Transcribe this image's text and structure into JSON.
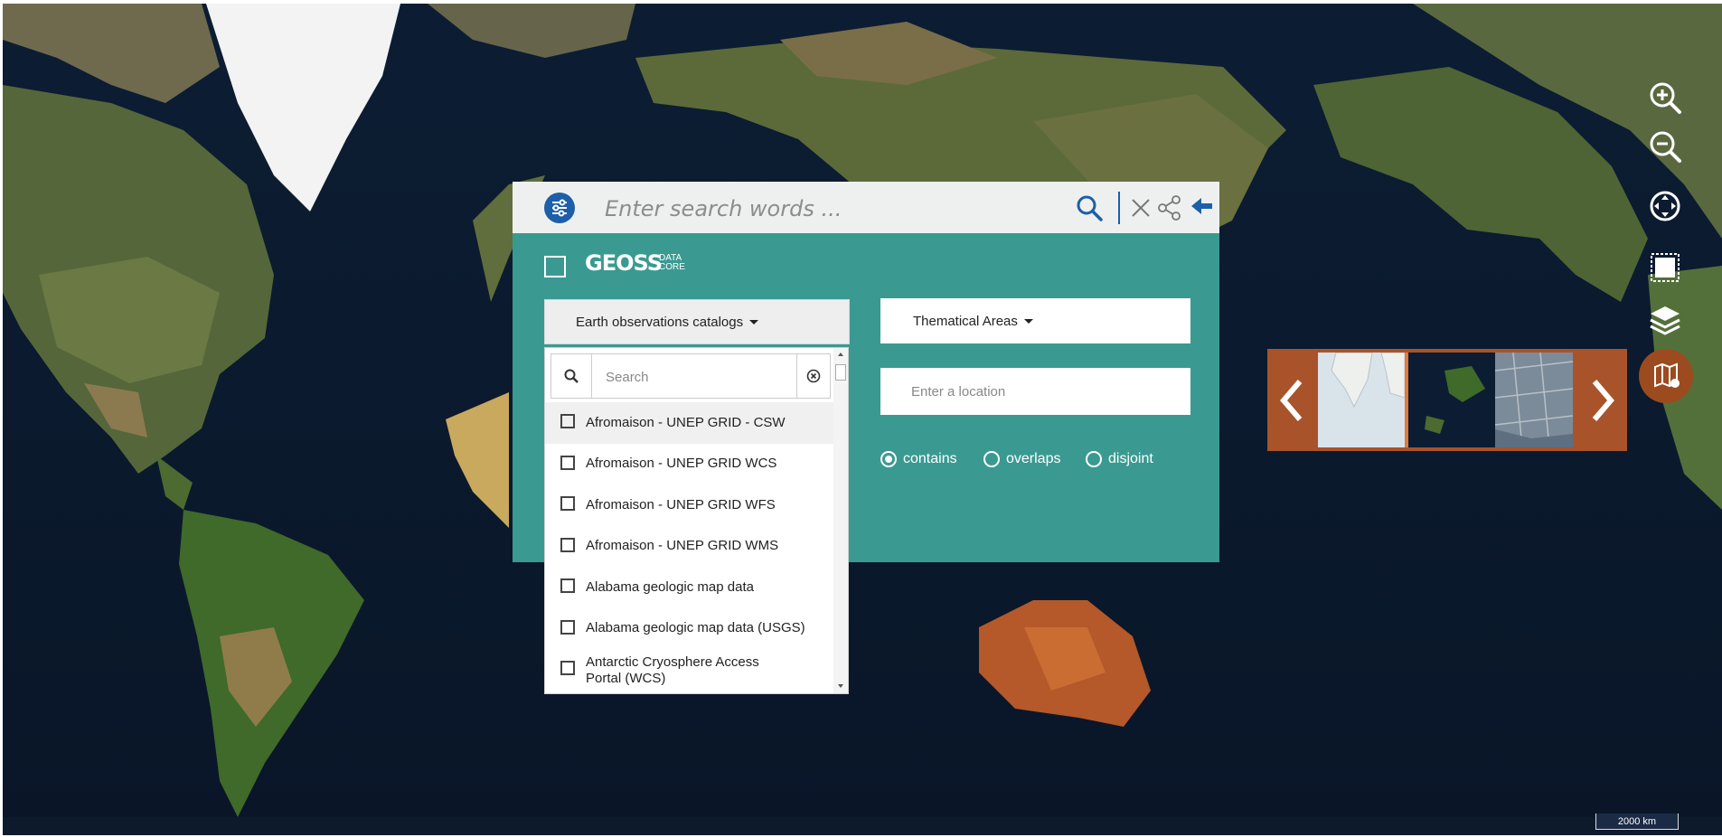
{
  "search": {
    "placeholder": "Enter search words ..."
  },
  "geoss": {
    "logo_main": "GEOSS",
    "logo_sub_1": "DATA",
    "logo_sub_2": "CORE"
  },
  "catalogs": {
    "button_label": "Earth observations catalogs",
    "search_placeholder": "Search",
    "items": [
      "Afromaison - UNEP GRID - CSW",
      "Afromaison - UNEP GRID WCS",
      "Afromaison - UNEP GRID WFS",
      "Afromaison - UNEP GRID WMS",
      "Alabama geologic map data",
      "Alabama geologic map data (USGS)",
      "Antarctic Cryosphere Access Portal (WCS)"
    ]
  },
  "thematical": {
    "button_label": "Thematical Areas"
  },
  "location": {
    "placeholder": "Enter a location"
  },
  "spatial_relation": {
    "options": [
      "contains",
      "overlaps",
      "disjoint"
    ],
    "selected": "contains"
  },
  "scale": {
    "label": "2000 km"
  },
  "colors": {
    "panel": "#3a9a92",
    "accent": "#1d5fa8",
    "carousel": "#a9532a"
  },
  "icons": [
    "filter-icon",
    "search-icon",
    "close-icon",
    "share-icon",
    "back-arrow-icon",
    "zoom-in-icon",
    "zoom-out-icon",
    "pan-icon",
    "select-area-icon",
    "layers-icon",
    "basemap-icon",
    "chevron-left-icon",
    "chevron-right-icon"
  ]
}
